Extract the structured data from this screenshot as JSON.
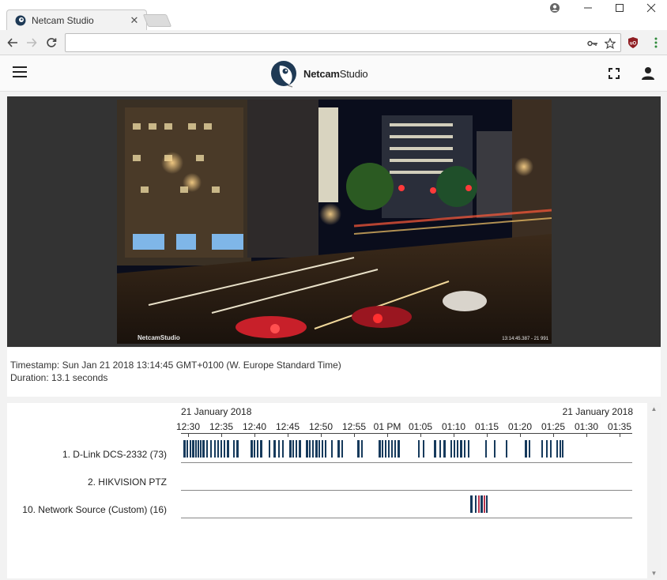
{
  "browser": {
    "tab_title": "Netcam Studio",
    "tab_close": "✕",
    "address_value": "",
    "window_controls": [
      "account-circle-icon",
      "minimize-icon",
      "maximize-icon",
      "close-icon"
    ]
  },
  "header": {
    "brand_part1": "Netcam",
    "brand_part2": "Studio"
  },
  "video": {
    "watermark": "NetcamStudio",
    "overlay_timestamp": "13:14:45.387 - 21 991"
  },
  "info": {
    "timestamp_line": "Timestamp: Sun Jan 21 2018 13:14:45 GMT+0100 (W. Europe Standard Time)",
    "duration_line": "Duration: 13.1 seconds"
  },
  "timeline": {
    "date_left": "21 January 2018",
    "date_right": "21 January 2018",
    "ticks": [
      "12:30",
      "12:35",
      "12:40",
      "12:45",
      "12:50",
      "12:55",
      "01 PM",
      "01:05",
      "01:10",
      "01:15",
      "01:20",
      "01:25",
      "01:30",
      "01:35"
    ],
    "rows": [
      {
        "label": "1. D-Link DCS-2332 (73)"
      },
      {
        "label": "2. HIKVISION PTZ"
      },
      {
        "label": "10. Network Source (Custom) (16)"
      }
    ]
  },
  "colors": {
    "event": "#163a5c",
    "event_alert": "#b8344c",
    "video_bg": "#333333"
  }
}
